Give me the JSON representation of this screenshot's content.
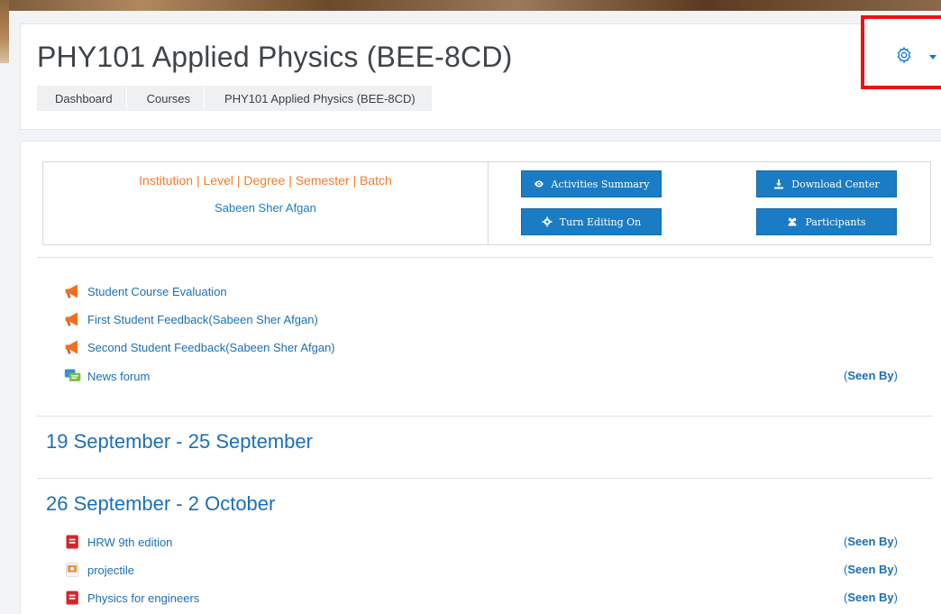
{
  "header": {
    "title": "PHY101 Applied Physics (BEE-8CD)",
    "breadcrumb": [
      "Dashboard",
      "Courses",
      "PHY101 Applied Physics (BEE-8CD)"
    ]
  },
  "course_info": {
    "meta": "Institution | Level | Degree | Semester | Batch",
    "teacher": "Sabeen Sher Afgan"
  },
  "buttons": {
    "activities_summary": "Activities Summary",
    "download_center": "Download Center",
    "turn_editing_on": "Turn Editing On",
    "participants": "Participants"
  },
  "general_activities": [
    {
      "label": "Student Course Evaluation",
      "icon": "megaphone-icon"
    },
    {
      "label": "First Student Feedback(Sabeen Sher Afgan)",
      "icon": "megaphone-icon"
    },
    {
      "label": "Second Student Feedback(Sabeen Sher Afgan)",
      "icon": "megaphone-icon"
    },
    {
      "label": "News forum",
      "icon": "forum-icon",
      "seen_by": "Seen By"
    }
  ],
  "sections": [
    {
      "title": "19 September - 25 September",
      "activities": []
    },
    {
      "title": "26 September - 2 October",
      "activities": [
        {
          "label": "HRW 9th edition",
          "icon": "pdf-icon",
          "seen_by": "Seen By"
        },
        {
          "label": "projectile",
          "icon": "pptx-icon",
          "seen_by": "Seen By"
        },
        {
          "label": "Physics for engineers",
          "icon": "pdf-icon",
          "seen_by": "Seen By"
        }
      ]
    }
  ],
  "colors": {
    "accent": "#1a7cc4",
    "link": "#1b6fb8",
    "meta_orange": "#f37a2a",
    "highlight_red": "#ee1111"
  }
}
